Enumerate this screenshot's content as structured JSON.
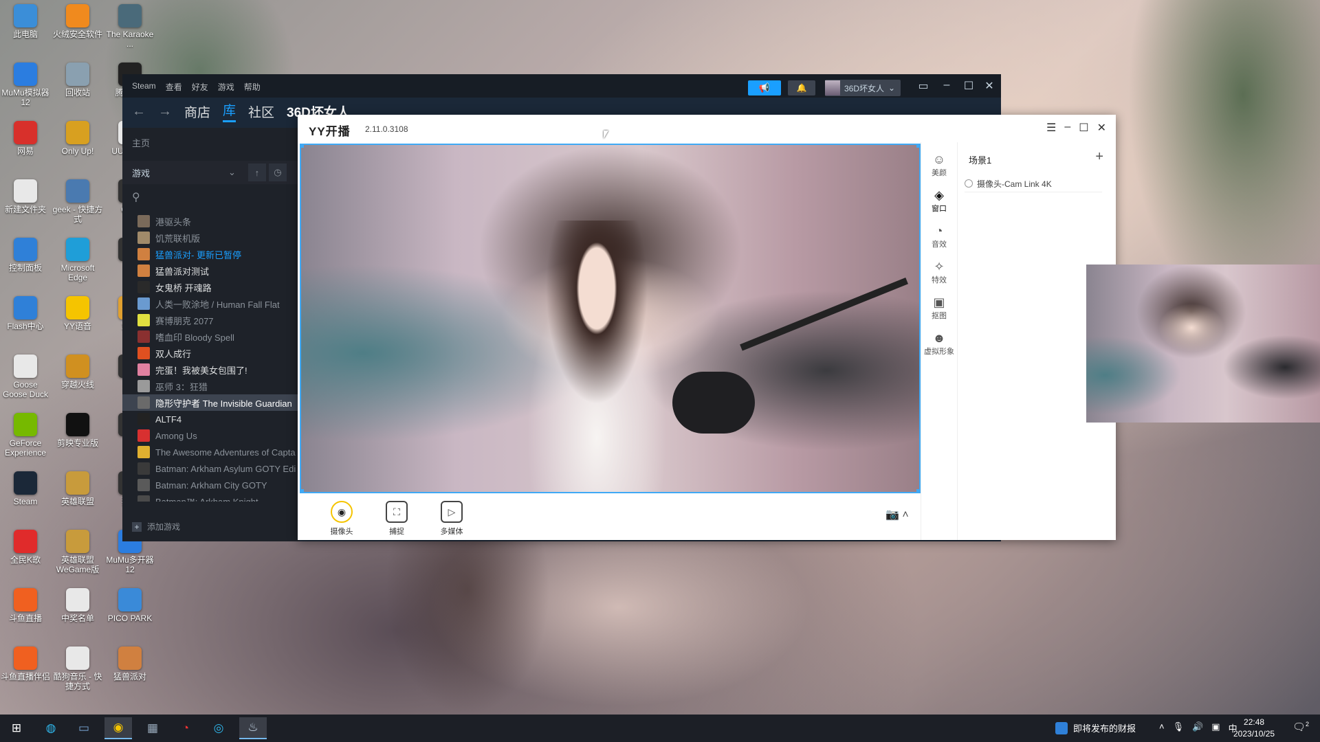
{
  "desktop": {
    "icons": [
      {
        "label": "此电脑",
        "color": "#3b8ed8"
      },
      {
        "label": "火绒安全软件",
        "color": "#f08a1e"
      },
      {
        "label": "The Karaoke ...",
        "color": "#4a6a7a"
      },
      {
        "label": "MuMu模拟器12",
        "color": "#2b7de0"
      },
      {
        "label": "回收站",
        "color": "#8aa0b0"
      },
      {
        "label": "腾讯QQ",
        "color": "#222222"
      },
      {
        "label": "网易",
        "color": "#d8302b"
      },
      {
        "label": "Only Up!",
        "color": "#d8a020"
      },
      {
        "label": "UU加速器",
        "color": "#e8e8e8"
      },
      {
        "label": "新建文件夹",
        "color": "#e8e8e8"
      },
      {
        "label": "geek - 快捷方式",
        "color": "#4a7ab0"
      },
      {
        "label": "OBS",
        "color": "#333333"
      },
      {
        "label": "控制面板",
        "color": "#2f80d8"
      },
      {
        "label": "Microsoft Edge",
        "color": "#1f9ed8"
      },
      {
        "label": "Q",
        "color": "#333333"
      },
      {
        "label": "Flash中心",
        "color": "#2f80d8"
      },
      {
        "label": "YY语音",
        "color": "#f5c400"
      },
      {
        "label": "欢乐",
        "color": "#e0a030"
      },
      {
        "label": "Goose Goose Duck",
        "color": "#e8e8e8"
      },
      {
        "label": "穿越火线",
        "color": "#d09020"
      },
      {
        "label": "Pu",
        "color": "#333333"
      },
      {
        "label": "GeForce Experience",
        "color": "#76b900"
      },
      {
        "label": "剪映专业版",
        "color": "#111111"
      },
      {
        "label": "V",
        "color": "#333333"
      },
      {
        "label": "Steam",
        "color": "#1b2838"
      },
      {
        "label": "英雄联盟",
        "color": "#c89b3c"
      },
      {
        "label": "猛兽",
        "color": "#333333"
      },
      {
        "label": "全民K歌",
        "color": "#e02b2b"
      },
      {
        "label": "英雄联盟WeGame版",
        "color": "#c89b3c"
      },
      {
        "label": "MuMu多开器12",
        "color": "#2b7de0"
      },
      {
        "label": "斗鱼直播",
        "color": "#f06020"
      },
      {
        "label": "中奖名单",
        "color": "#e8e8e8"
      },
      {
        "label": "PICO PARK",
        "color": "#3a8ad8"
      },
      {
        "label": "斗鱼直播伴侣",
        "color": "#f06020"
      },
      {
        "label": "酷狗音乐 - 快捷方式",
        "color": "#e8e8e8"
      },
      {
        "label": "猛兽派对",
        "color": "#d08040"
      }
    ]
  },
  "steam": {
    "menu": [
      "Steam",
      "查看",
      "好友",
      "游戏",
      "帮助"
    ],
    "username": "36D坏女人",
    "nav": {
      "store": "商店",
      "library": "库",
      "community": "社区",
      "profile": "36D坏女人"
    },
    "home": "主页",
    "filter_label": "游戏",
    "games": [
      {
        "name": "港驱头条",
        "style": "dim",
        "color": "#7a6a5a"
      },
      {
        "name": "饥荒联机版",
        "style": "dim",
        "color": "#a08a6a"
      },
      {
        "name": "猛兽派对",
        "status": " - 更新已暂停",
        "style": "update",
        "color": "#d08040"
      },
      {
        "name": "猛兽派对测试",
        "style": "bright",
        "color": "#d08040"
      },
      {
        "name": "女鬼桥 开魂路",
        "style": "bright",
        "color": "#2a2a2a"
      },
      {
        "name": "人类一败涂地 / Human Fall Flat",
        "style": "dim",
        "color": "#6a9ad0"
      },
      {
        "name": "赛博朋克 2077",
        "style": "dim",
        "color": "#e0e040"
      },
      {
        "name": "嗜血印 Bloody Spell",
        "style": "dim",
        "color": "#8a3030"
      },
      {
        "name": "双人成行",
        "style": "bright",
        "color": "#e05020"
      },
      {
        "name": "完蛋！我被美女包围了!",
        "style": "bright",
        "color": "#e080a0"
      },
      {
        "name": "巫师 3：狂猎",
        "style": "dim",
        "color": "#9a9a9a"
      },
      {
        "name": "隐形守护者 The Invisible Guardian",
        "style": "selected",
        "color": "#6a6a6a"
      },
      {
        "name": "ALTF4",
        "style": "bright",
        "color": "#222222"
      },
      {
        "name": "Among Us",
        "style": "dim",
        "color": "#d83030"
      },
      {
        "name": "The Awesome Adventures of Capta",
        "style": "dim",
        "color": "#e0b030"
      },
      {
        "name": "Batman: Arkham Asylum GOTY Edi",
        "style": "dim",
        "color": "#3a3a3a"
      },
      {
        "name": "Batman: Arkham City GOTY",
        "style": "dim",
        "color": "#5a5a5a"
      },
      {
        "name": "Batman™: Arkham Knight",
        "style": "dim",
        "color": "#4a4a4a"
      }
    ],
    "add_game": "添加游戏"
  },
  "yy": {
    "brand": "YY开播",
    "version": "2.11.0.3108",
    "sources": [
      {
        "label": "摄像头",
        "icon": "◉"
      },
      {
        "label": "捕捉",
        "icon": "⛶"
      },
      {
        "label": "多媒体",
        "icon": "▷"
      }
    ],
    "tools": [
      {
        "label": "美颜",
        "icon": "☺"
      },
      {
        "label": "窗口",
        "icon": "◈"
      },
      {
        "label": "音效",
        "icon": "◔"
      },
      {
        "label": "特效",
        "icon": "✧"
      },
      {
        "label": "抠图",
        "icon": "▣"
      },
      {
        "label": "虚拟形象",
        "icon": "☻"
      }
    ],
    "scene": {
      "title": "场景1",
      "add": "+",
      "item": "摄像头-Cam Link 4K"
    }
  },
  "taskbar": {
    "news": "即将发布的财报",
    "ime": "中",
    "time": "22:48",
    "date": "2023/10/25",
    "notif_count": "2"
  }
}
